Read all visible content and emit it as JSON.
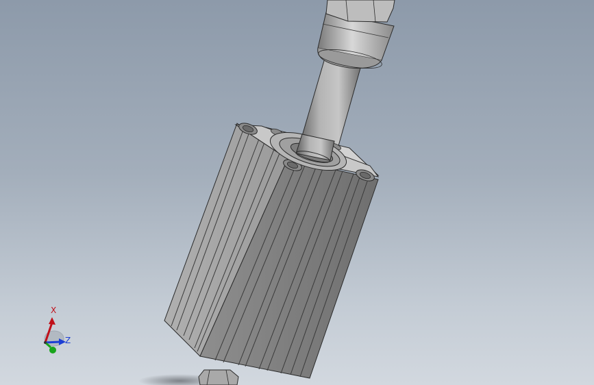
{
  "triad": {
    "x_label": "X",
    "z_label": "Z",
    "colors": {
      "x": "#c0101a",
      "y": "#19a51c",
      "z": "#1c3fd4"
    }
  },
  "colors": {
    "background_top": "#8d9aaa",
    "background_bottom": "#d2d8df",
    "body_light": "#c9c9c9",
    "body_mid": "#9c9c9c",
    "body_dark": "#6f6f6f",
    "edge": "#2a2a2a"
  }
}
